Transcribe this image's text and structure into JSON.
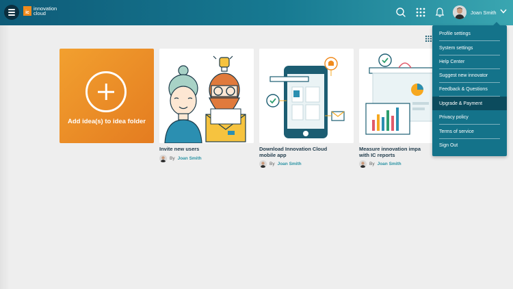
{
  "app": {
    "logo_abbr": "ic",
    "logo_line1": "innovation",
    "logo_line2": "cloud"
  },
  "header": {
    "icons": [
      "search-icon",
      "apps-grid-icon",
      "bell-icon"
    ],
    "user_name": "Joan Smith"
  },
  "add_card": {
    "label": "Add idea(s) to idea folder"
  },
  "cards": [
    {
      "title": "Invite new users",
      "title_line2": "",
      "by": "By",
      "author": "Joan Smith"
    },
    {
      "title": "Download Innovation Cloud",
      "title_line2": "mobile app",
      "by": "By",
      "author": "Joan Smith"
    },
    {
      "title": "Measure innovation impa",
      "title_line2": "with IC reports",
      "by": "By",
      "author": "Joan Smith"
    }
  ],
  "dropdown": {
    "items": [
      {
        "label": "Profile settings"
      },
      {
        "label": "System settings"
      },
      {
        "label": "Help Center"
      },
      {
        "label": "Suggest new innovator"
      },
      {
        "label": "Feedback & Questions"
      },
      {
        "label": "Upgrade & Payment",
        "active": true
      },
      {
        "label": "Privacy policy"
      },
      {
        "label": "Terms of service"
      },
      {
        "label": "Sign Out"
      }
    ]
  },
  "colors": {
    "header_dark": "#0e5b78",
    "header_light": "#3aa6b1",
    "accent_orange": "#f08a1c",
    "dropdown_bg": "#14738a",
    "dropdown_active": "#0c4b5d",
    "author_link": "#2a93a4"
  }
}
